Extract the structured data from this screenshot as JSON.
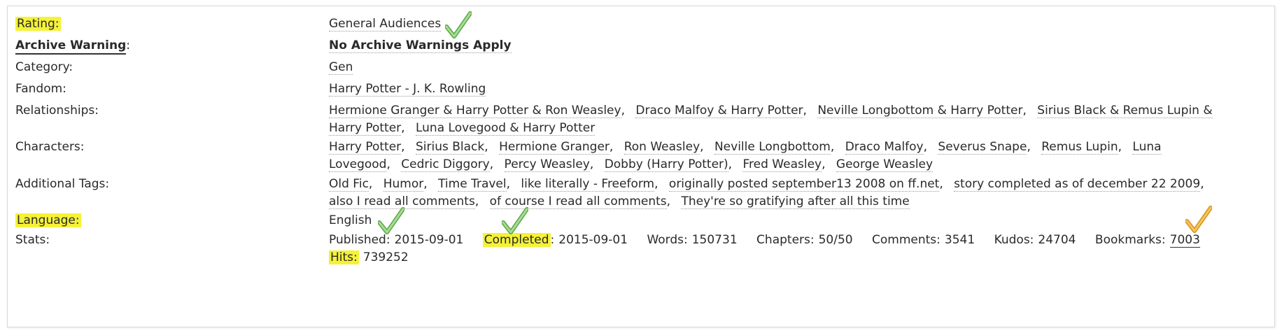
{
  "labels": {
    "rating": "Rating:",
    "archive_warning": "Archive Warning",
    "archive_warning_colon": ":",
    "category": "Category:",
    "fandom": "Fandom:",
    "relationships": "Relationships:",
    "characters": "Characters:",
    "additional_tags": "Additional Tags:",
    "language": "Language:",
    "stats": "Stats:"
  },
  "values": {
    "rating": "General Audiences",
    "archive_warning": "No Archive Warnings Apply",
    "category": "Gen",
    "fandom": "Harry Potter - J. K. Rowling",
    "relationships": [
      "Hermione Granger & Harry Potter & Ron Weasley",
      "Draco Malfoy & Harry Potter",
      "Neville Longbottom & Harry Potter",
      "Sirius Black & Remus Lupin & Harry Potter",
      "Luna Lovegood & Harry Potter"
    ],
    "characters": [
      "Harry Potter",
      "Sirius Black",
      "Hermione Granger",
      "Ron Weasley",
      "Neville Longbottom",
      "Draco Malfoy",
      "Severus Snape",
      "Remus Lupin",
      "Luna Lovegood",
      "Cedric Diggory",
      "Percy Weasley",
      "Dobby (Harry Potter)",
      "Fred Weasley",
      "George Weasley"
    ],
    "additional_tags": [
      "Old Fic",
      "Humor",
      "Time Travel",
      "like literally - Freeform",
      "originally posted september13 2008 on ff.net",
      "story completed as of december 22 2009",
      "also I read all comments",
      "of course I read all comments",
      "They're so gratifying after all this time"
    ],
    "language": "English",
    "stats": {
      "published_label": "Published:",
      "published": "2015-09-01",
      "completed_label": "Completed",
      "completed_colon": ":",
      "completed": "2015-09-01",
      "words_label": "Words:",
      "words": "150731",
      "chapters_label": "Chapters:",
      "chapters": "50/50",
      "comments_label": "Comments:",
      "comments": "3541",
      "kudos_label": "Kudos:",
      "kudos": "24704",
      "bookmarks_label": "Bookmarks:",
      "bookmarks": "7003",
      "hits_label": "Hits:",
      "hits": "739252"
    }
  },
  "colors": {
    "highlight": "#f5f237",
    "check_green": "#7cc26b",
    "check_orange": "#f2b233"
  },
  "icons": [
    "check-mark-green-icon",
    "check-mark-orange-icon"
  ]
}
